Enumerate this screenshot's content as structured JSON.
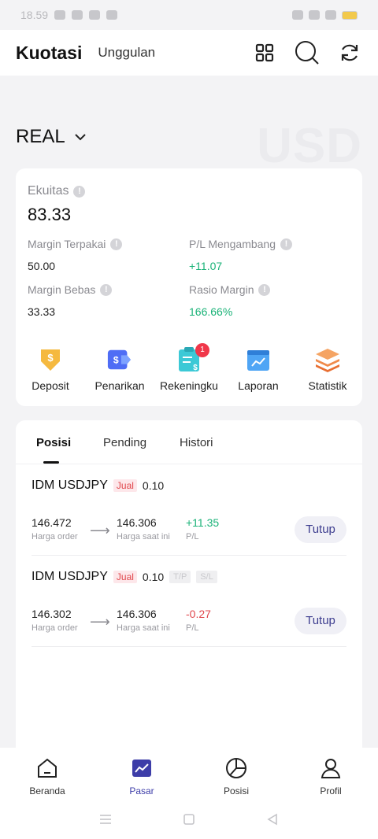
{
  "status_bar": {
    "time": "18.59"
  },
  "header": {
    "title": "Kuotasi",
    "subtab": "Unggulan"
  },
  "account": {
    "type": "REAL",
    "currency_watermark": "USD"
  },
  "summary": {
    "equity_label": "Ekuitas",
    "equity_value": "83.33",
    "metrics": [
      {
        "label": "Margin Terpakai",
        "value": "50.00"
      },
      {
        "label": "P/L Mengambang",
        "value": "+11.07"
      },
      {
        "label": "Margin Bebas",
        "value": "33.33"
      },
      {
        "label": "Rasio Margin",
        "value": "166.66%"
      }
    ]
  },
  "actions": [
    {
      "label": "Deposit",
      "icon": "deposit-icon"
    },
    {
      "label": "Penarikan",
      "icon": "withdraw-icon"
    },
    {
      "label": "Rekeningku",
      "icon": "account-icon",
      "badge": "1"
    },
    {
      "label": "Laporan",
      "icon": "report-icon"
    },
    {
      "label": "Statistik",
      "icon": "statistics-icon"
    }
  ],
  "tabs": [
    "Posisi",
    "Pending",
    "Histori"
  ],
  "positions": [
    {
      "symbol": "IDM USDJPY",
      "side": "Jual",
      "lot": "0.10",
      "tp": "",
      "sl": "",
      "order_price": "146.472",
      "order_price_label": "Harga order",
      "current_price": "146.306",
      "current_price_label": "Harga saat ini",
      "pl": "+11.35",
      "pl_label": "P/L",
      "close_label": "Tutup"
    },
    {
      "symbol": "IDM USDJPY",
      "side": "Jual",
      "lot": "0.10",
      "tp": "T/P",
      "sl": "S/L",
      "order_price": "146.302",
      "order_price_label": "Harga order",
      "current_price": "146.306",
      "current_price_label": "Harga saat ini",
      "pl": "-0.27",
      "pl_label": "P/L",
      "close_label": "Tutup"
    }
  ],
  "bottom_nav": [
    {
      "label": "Beranda",
      "icon": "home-icon"
    },
    {
      "label": "Pasar",
      "icon": "market-icon",
      "active": true
    },
    {
      "label": "Posisi",
      "icon": "pie-chart-icon"
    },
    {
      "label": "Profil",
      "icon": "profile-icon"
    }
  ],
  "colors": {
    "profit": "#19b277",
    "loss": "#e0474c",
    "accent": "#3d3da8"
  }
}
